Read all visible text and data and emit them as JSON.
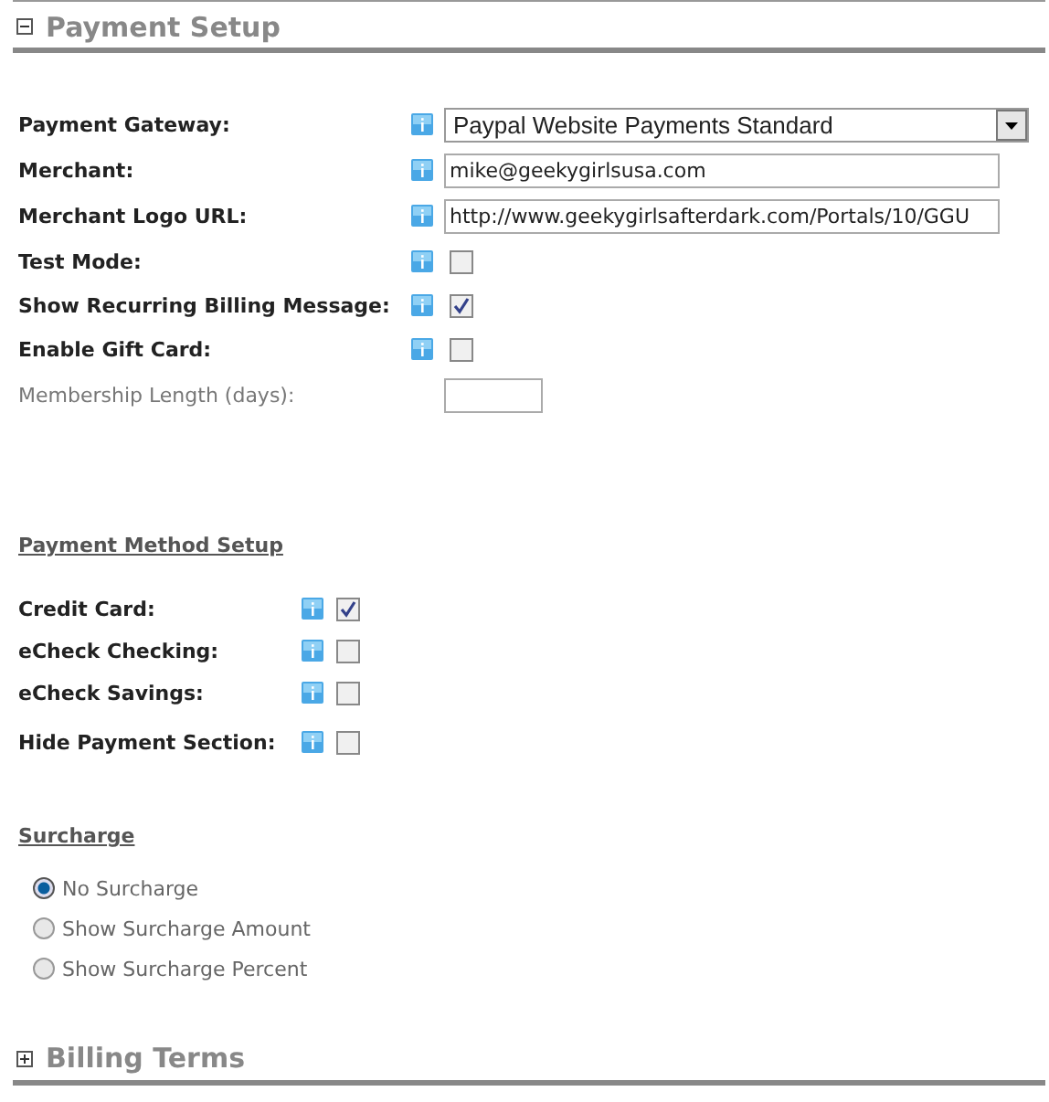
{
  "payment_setup": {
    "title": "Payment Setup",
    "expanded": true
  },
  "settings": [
    {
      "kind": "select",
      "label": "Payment Gateway:",
      "value": "Paypal Website Payments Standard"
    },
    {
      "kind": "text",
      "label": "Merchant:",
      "value": "mike@geekygirlsusa.com"
    },
    {
      "kind": "text",
      "label": "Merchant Logo URL:",
      "value": "http://www.geekygirlsafterdark.com/Portals/10/GGU"
    },
    {
      "kind": "checkbox",
      "label": "Test Mode:",
      "checked": false
    },
    {
      "kind": "checkbox",
      "label": "Show Recurring Billing Message:",
      "checked": true
    },
    {
      "kind": "checkbox",
      "label": "Enable Gift Card:",
      "checked": false
    },
    {
      "kind": "short_text",
      "label": "Membership Length (days):"
    }
  ],
  "payment_method_setup": {
    "heading": "Payment Method Setup",
    "methods": [
      {
        "label": "Credit Card:",
        "checked": true
      },
      {
        "label": "eCheck Checking:",
        "checked": false
      },
      {
        "label": "eCheck Savings:",
        "checked": false
      },
      {
        "label": "Hide Payment Section:",
        "checked": false
      }
    ]
  },
  "surcharge": {
    "heading": "Surcharge",
    "options": [
      {
        "label": "No Surcharge",
        "selected": true
      },
      {
        "label": "Show Surcharge Amount",
        "selected": false
      },
      {
        "label": "Show Surcharge Percent",
        "selected": false
      }
    ]
  },
  "billing_terms": {
    "title": "Billing Terms",
    "expanded": false
  }
}
